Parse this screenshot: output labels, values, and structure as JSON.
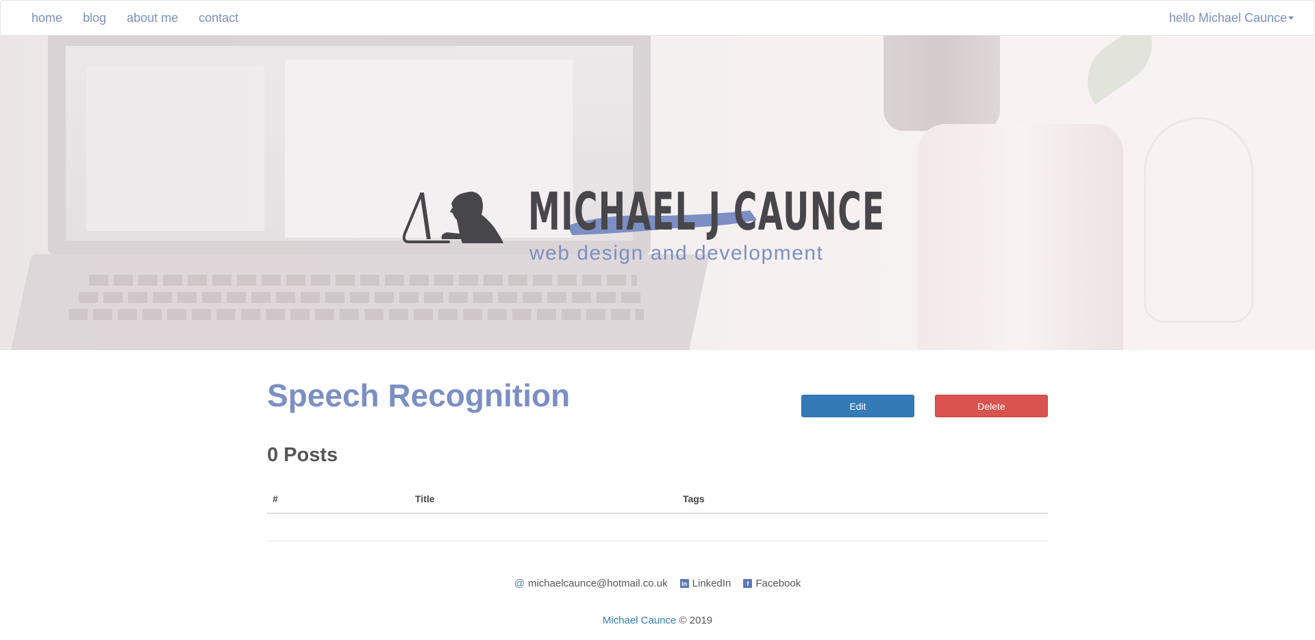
{
  "nav": {
    "links": [
      "home",
      "blog",
      "about me",
      "contact"
    ],
    "user_menu": "hello Michael Caunce"
  },
  "hero": {
    "logo_title": "MICHAEL J CAUNCE",
    "logo_subtitle": "web design and development"
  },
  "main": {
    "title": "Speech Recognition",
    "edit_label": "Edit",
    "delete_label": "Delete",
    "posts_count": "0 Posts",
    "table": {
      "headers": [
        "#",
        "Title",
        "Tags"
      ],
      "rows": []
    }
  },
  "footer": {
    "email_icon": "at-icon",
    "email": "michaelcaunce@hotmail.co.uk",
    "linkedin_icon": "linkedin-icon",
    "linkedin": "LinkedIn",
    "facebook_icon": "facebook-icon",
    "facebook": "Facebook",
    "copyright_name": "Michael Caunce",
    "copyright_text": "© 2019"
  },
  "colors": {
    "accent": "#7b8fc4",
    "edit_button": "#337ab7",
    "delete_button": "#d9534f",
    "logo_dark": "#47464a"
  }
}
